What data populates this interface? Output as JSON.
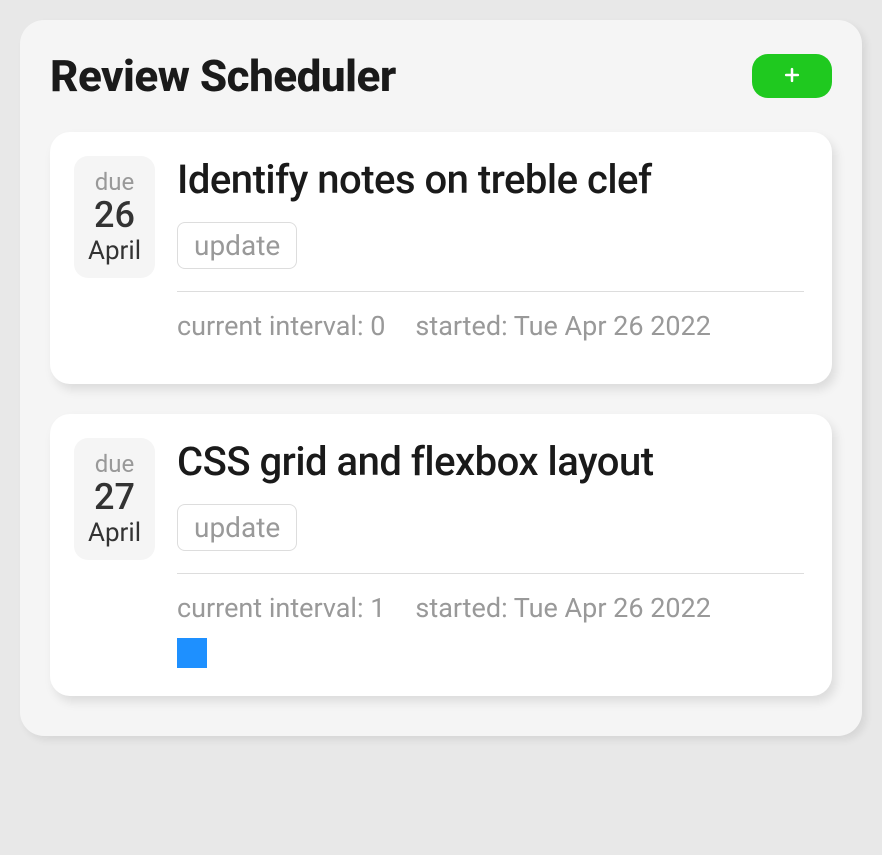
{
  "header": {
    "title": "Review Scheduler"
  },
  "cards": [
    {
      "due_label": "due",
      "day": "26",
      "month": "April",
      "title": "Identify notes on treble clef",
      "update_label": "update",
      "interval_label": "current interval: ",
      "interval_value": "0",
      "started_label": "started: ",
      "started_value": "Tue Apr 26 2022",
      "progress_blocks": 0
    },
    {
      "due_label": "due",
      "day": "27",
      "month": "April",
      "title": "CSS grid and flexbox layout",
      "update_label": "update",
      "interval_label": "current interval: ",
      "interval_value": "1",
      "started_label": "started: ",
      "started_value": "Tue Apr 26 2022",
      "progress_blocks": 1
    }
  ]
}
